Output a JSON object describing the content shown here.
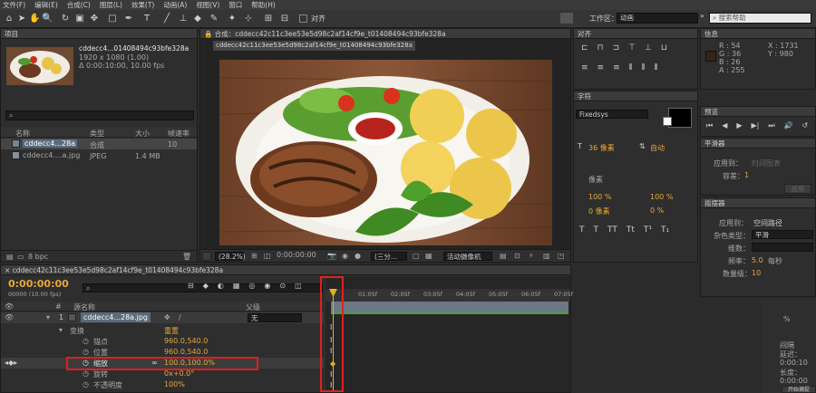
{
  "menu": [
    "文件(F)",
    "编辑(E)",
    "合成(C)",
    "图层(L)",
    "效果(T)",
    "动画(A)",
    "视图(V)",
    "窗口",
    "帮助(H)"
  ],
  "toolbar": {
    "align_label": "对齐",
    "workspace_label": "工作区：",
    "workspace_value": "动画",
    "search_placeholder": "搜索帮助"
  },
  "project": {
    "title": "项目",
    "comp_name": "cddecc4...01408494c93bfe328a",
    "comp_res": "1920 x 1080 (1.00)",
    "comp_time": "Δ 0:00:10:00, 10.00 fps",
    "col_name": "名称",
    "col_type": "类型",
    "col_size": "大小",
    "col_rate": "帧速率",
    "items": [
      {
        "name": "cddecc4...28a",
        "type": "合成",
        "size": "",
        "rate": "10"
      },
      {
        "name": "cddecc4....a.jpg",
        "type": "JPEG",
        "size": "1.4 MB",
        "rate": ""
      }
    ],
    "bpc": "8 bpc"
  },
  "comp": {
    "tab_label": "合成：cddecc42c11c3ee53e5d98c2af14cf9e_t01408494c93bfe328a",
    "subtab": "cddecc42c11c3ee53e5d98c2af14cf9e_t01408494c93bfe328a",
    "zoom": "(28.2%)",
    "time": "0:00:00:00",
    "res": "(三分...",
    "camera": "活动摄像机"
  },
  "align": {
    "title": "对齐"
  },
  "info": {
    "title": "信息",
    "r": "R : 54",
    "g": "G : 36",
    "b": "B : 26",
    "a": "A : 255",
    "x": "X : 1731",
    "y": "Y : 980"
  },
  "character": {
    "title": "字符",
    "font": "Fixedsys",
    "size": "36 像素",
    "leading": "自动",
    "tracking": "像素",
    "v_scale": "100 %",
    "h_scale": "100 %",
    "stroke": "像素",
    "baseline": "0 像素",
    "tsume": "0 %"
  },
  "preview": {
    "title": "预览"
  },
  "smoother": {
    "title": "平滑器",
    "apply_to": "应用到：",
    "apply_val": "时间图表",
    "tolerance": "容差：",
    "tol_val": "1",
    "apply_btn": "应用"
  },
  "wiggler": {
    "title": "摇摆器",
    "apply_to": "应用到：",
    "apply_val": "空间路径",
    "noise": "杂色类型：",
    "noise_val": "平滑",
    "dims": "维数：",
    "freq": "频率：",
    "freq_val": "5.0",
    "freq_unit": "每秒",
    "mag": "数量级：",
    "mag_val": "10"
  },
  "timeline": {
    "tab": "cddecc42c11c3ee53e5d98c2af14cf9e_t01408494c93bfe328a",
    "timecode": "0:00:00:00",
    "fps": "00000 (10.00 fps)",
    "col_source": "源名称",
    "col_parent": "父级",
    "layer_num": "1",
    "layer_name": "cddecc4...28a.jpg",
    "parent_val": "无",
    "transform": "变换",
    "reset": "重置",
    "props": [
      {
        "name": "锚点",
        "value": "960.0,540.0"
      },
      {
        "name": "位置",
        "value": "960.0,540.0"
      },
      {
        "name": "缩放",
        "value": "100.0,100.0%"
      },
      {
        "name": "旋转",
        "value": "0x+0.0°"
      },
      {
        "name": "不透明度",
        "value": "100%"
      }
    ],
    "ruler": [
      "01:05f",
      "02:05f",
      "03:05f",
      "04:05f",
      "05:05f",
      "06:05f",
      "07:05f",
      "08:05f"
    ]
  },
  "right_bottom": {
    "pct": "%",
    "l1": "间隔",
    "l2": "延迟：",
    "l3": "0:00:10",
    "l4": "长度：",
    "l5": "0:00:00",
    "btn": "开始捕捉"
  }
}
